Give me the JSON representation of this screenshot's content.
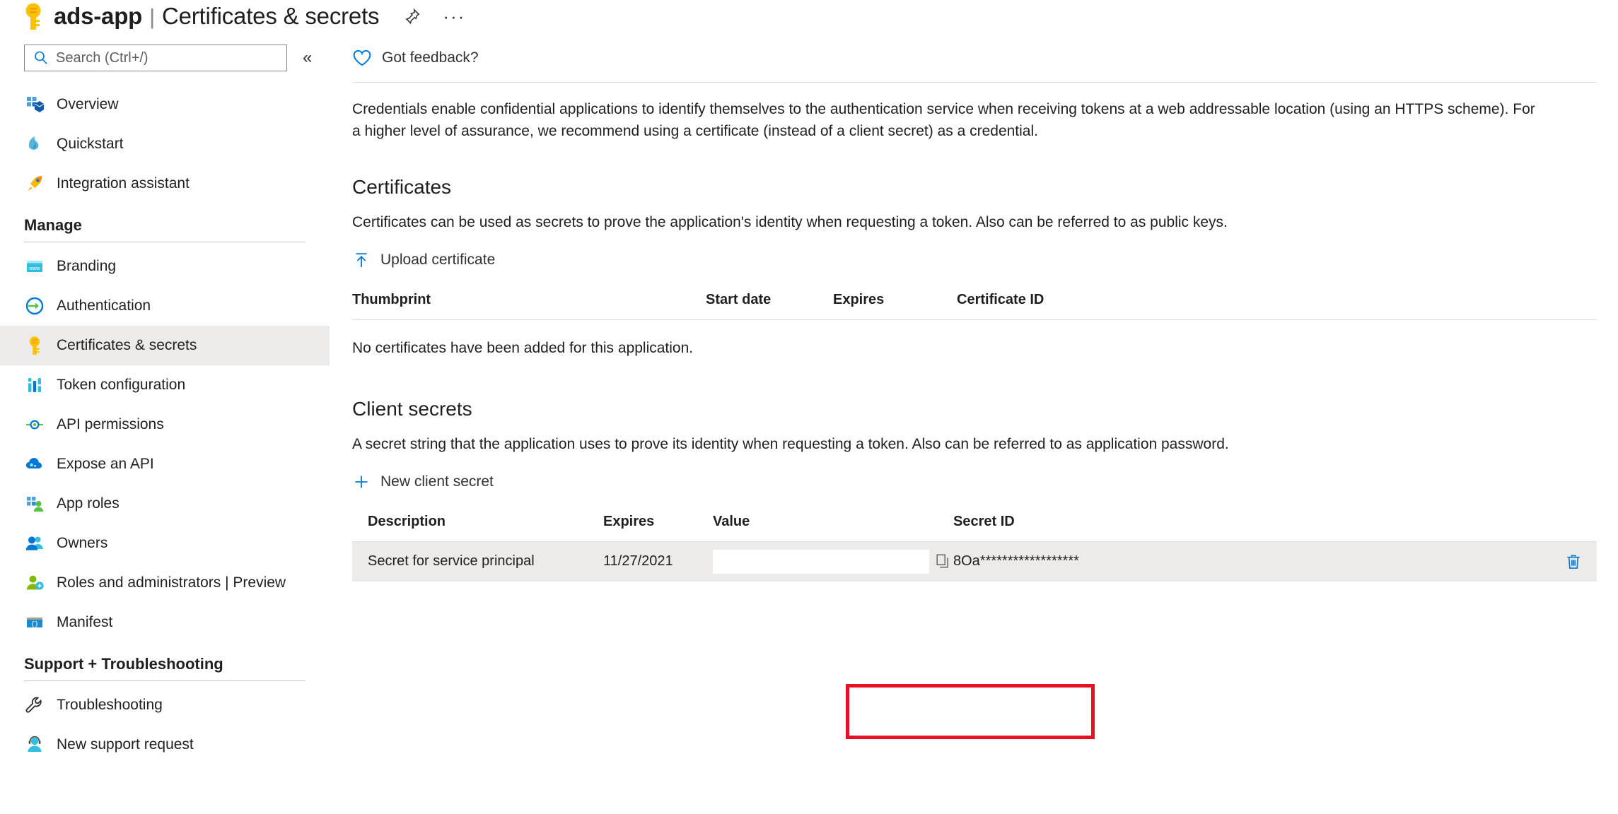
{
  "header": {
    "app_name": "ads-app",
    "separator": "|",
    "page_name": "Certificates & secrets",
    "pin_icon": "pin-icon",
    "more_icon": "more-ellipsis-icon"
  },
  "sidebar": {
    "search": {
      "placeholder": "Search (Ctrl+/)",
      "value": "",
      "icon": "search-icon"
    },
    "collapse_icon": "«",
    "top_items": [
      {
        "label": "Overview",
        "icon": "overview-icon"
      },
      {
        "label": "Quickstart",
        "icon": "quickstart-icon"
      },
      {
        "label": "Integration assistant",
        "icon": "rocket-icon"
      }
    ],
    "groups": [
      {
        "title": "Manage",
        "items": [
          {
            "label": "Branding",
            "icon": "branding-icon"
          },
          {
            "label": "Authentication",
            "icon": "authentication-icon"
          },
          {
            "label": "Certificates & secrets",
            "icon": "key-icon",
            "selected": true
          },
          {
            "label": "Token configuration",
            "icon": "token-icon"
          },
          {
            "label": "API permissions",
            "icon": "api-permissions-icon"
          },
          {
            "label": "Expose an API",
            "icon": "expose-api-icon"
          },
          {
            "label": "App roles",
            "icon": "app-roles-icon"
          },
          {
            "label": "Owners",
            "icon": "owners-icon"
          },
          {
            "label": "Roles and administrators | Preview",
            "icon": "roles-admin-icon"
          },
          {
            "label": "Manifest",
            "icon": "manifest-icon"
          }
        ]
      },
      {
        "title": "Support + Troubleshooting",
        "items": [
          {
            "label": "Troubleshooting",
            "icon": "wrench-icon"
          },
          {
            "label": "New support request",
            "icon": "support-agent-icon"
          }
        ]
      }
    ]
  },
  "content": {
    "feedback": {
      "label": "Got feedback?",
      "icon": "heart-icon"
    },
    "intro": "Credentials enable confidential applications to identify themselves to the authentication service when receiving tokens at a web addressable location (using an HTTPS scheme). For a higher level of assurance, we recommend using a certificate (instead of a client secret) as a credential.",
    "certificates": {
      "title": "Certificates",
      "description": "Certificates can be used as secrets to prove the application's identity when requesting a token. Also can be referred to as public keys.",
      "upload_button": {
        "label": "Upload certificate",
        "icon": "upload-icon"
      },
      "columns": [
        "Thumbprint",
        "Start date",
        "Expires",
        "Certificate ID"
      ],
      "rows": [],
      "empty_message": "No certificates have been added for this application."
    },
    "client_secrets": {
      "title": "Client secrets",
      "description": "A secret string that the application uses to prove its identity when requesting a token. Also can be referred to as application password.",
      "new_button": {
        "label": "New client secret",
        "icon": "plus-icon"
      },
      "columns": [
        "Description",
        "Expires",
        "Value",
        "Secret ID"
      ],
      "rows": [
        {
          "description": "Secret for service principal",
          "expires": "11/27/2021",
          "value": "",
          "copy_icon": "copy-icon",
          "secret_id": "8Oa******************",
          "delete_icon": "trash-icon"
        }
      ]
    }
  },
  "annotation": {
    "highlight_color": "#e81123",
    "highlight_target": "value-column-cell"
  }
}
